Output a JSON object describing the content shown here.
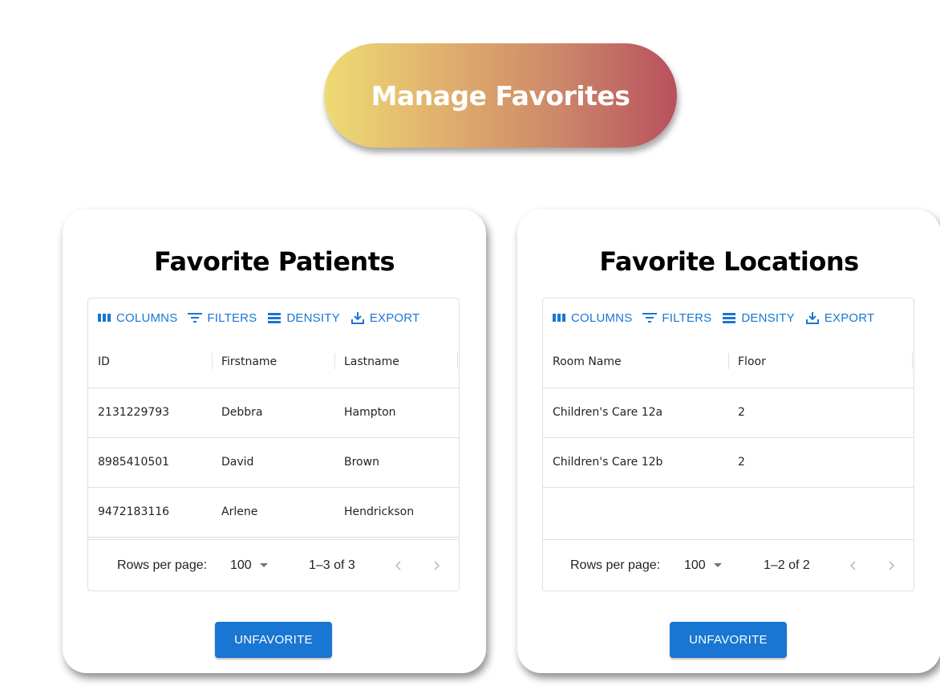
{
  "app": {
    "title": "Manage Favorites"
  },
  "toolbar": {
    "columns": "COLUMNS",
    "filters": "FILTERS",
    "density": "DENSITY",
    "export": "EXPORT"
  },
  "patients": {
    "title": "Favorite Patients",
    "columns": [
      "ID",
      "Firstname",
      "Lastname"
    ],
    "rows": [
      [
        "2131229793",
        "Debbra",
        "Hampton"
      ],
      [
        "8985410501",
        "David",
        "Brown"
      ],
      [
        "9472183116",
        "Arlene",
        "Hendrickson"
      ]
    ],
    "footer": {
      "rows_per_page_label": "Rows per page:",
      "rows_per_page_value": "100",
      "range": "1–3 of 3"
    },
    "action": "UNFAVORITE"
  },
  "locations": {
    "title": "Favorite Locations",
    "columns": [
      "Room Name",
      "Floor"
    ],
    "rows": [
      [
        "Children's Care 12a",
        "2"
      ],
      [
        "Children's Care 12b",
        "2"
      ]
    ],
    "footer": {
      "rows_per_page_label": "Rows per page:",
      "rows_per_page_value": "100",
      "range": "1–2 of 2"
    },
    "action": "UNFAVORITE"
  },
  "colors": {
    "accent": "#1976d2",
    "title_gradient": [
      "#eedb75",
      "#dfae6c",
      "#cd8a6a",
      "#b8505e"
    ]
  },
  "icons": {
    "columns": "view-column-icon",
    "filters": "filter-list-icon",
    "density": "density-icon",
    "export": "download-icon",
    "dropdown": "arrow-drop-down-icon",
    "prev": "chevron-left-icon",
    "next": "chevron-right-icon"
  }
}
